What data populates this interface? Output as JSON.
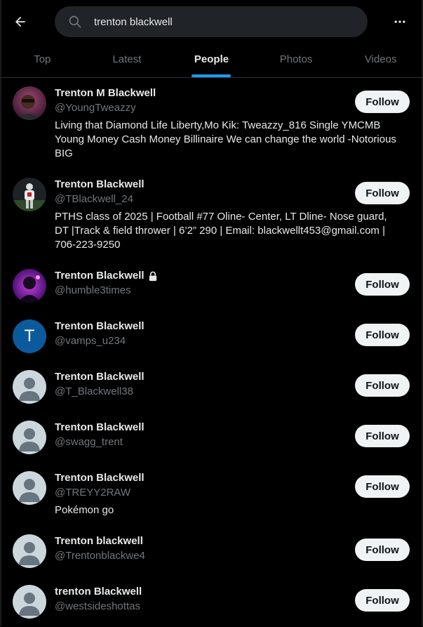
{
  "search": {
    "query": "trenton blackwell"
  },
  "tabs": [
    {
      "label": "Top",
      "active": false
    },
    {
      "label": "Latest",
      "active": false
    },
    {
      "label": "People",
      "active": true
    },
    {
      "label": "Photos",
      "active": false
    },
    {
      "label": "Videos",
      "active": false
    }
  ],
  "colors": {
    "accent": "#1d9bf0",
    "background": "#000000",
    "secondary_text": "#71767b"
  },
  "users": [
    {
      "name": "Trenton M Blackwell",
      "handle": "@YoungTweazzy",
      "bio": "Living that Diamond Life Liberty,Mo Kik: Tweazzy_816 Single YMCMB Young Money Cash Money Billinaire We can change the world -Notorious BIG",
      "follow_label": "Follow",
      "avatar": "photo"
    },
    {
      "name": "Trenton Blackwell",
      "handle": "@TBlackwell_24",
      "bio": "PTHS class of 2025 | Football #77 Oline- Center, LT Dline- Nose guard, DT |Track & field thrower | 6’2” 290 | Email: blackwellt453@gmail.com | 706-223-9250",
      "follow_label": "Follow",
      "avatar": "photo"
    },
    {
      "name": "Trenton Blackwell",
      "handle": "@humble3times",
      "bio": "",
      "follow_label": "Follow",
      "avatar": "photo",
      "protected": true
    },
    {
      "name": "Trenton Blackwell",
      "handle": "@vamps_u234",
      "bio": "",
      "follow_label": "Follow",
      "avatar": "letter",
      "letter": "T"
    },
    {
      "name": "Trenton Blackwell",
      "handle": "@T_Blackwell38",
      "bio": "",
      "follow_label": "Follow",
      "avatar": "default"
    },
    {
      "name": "Trenton Blackwell",
      "handle": "@swagg_trent",
      "bio": "",
      "follow_label": "Follow",
      "avatar": "default"
    },
    {
      "name": "Trenton Blackwell",
      "handle": "@TREYY2RAW",
      "bio": "Pokémon go",
      "follow_label": "Follow",
      "avatar": "default"
    },
    {
      "name": "Trenton blackwell",
      "handle": "@Trentonblackwe4",
      "bio": "",
      "follow_label": "Follow",
      "avatar": "default"
    },
    {
      "name": "trenton Blackwell",
      "handle": "@westsideshottas",
      "bio": "",
      "follow_label": "Follow",
      "avatar": "default"
    }
  ]
}
